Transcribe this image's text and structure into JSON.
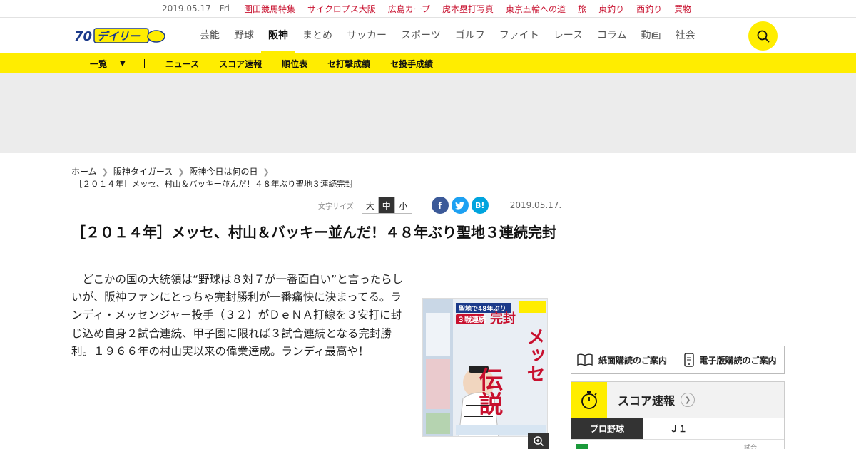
{
  "topbar": {
    "date": "2019.05.17 - Fri",
    "links": [
      "園田競馬特集",
      "サイクロプス大阪",
      "広島カープ",
      "虎本塁打写真",
      "東京五輪への道",
      "旅",
      "東釣り",
      "西釣り",
      "買物"
    ]
  },
  "header": {
    "logo_number": "70",
    "logo_text": "デイリー",
    "nav": [
      "芸能",
      "野球",
      "阪神",
      "まとめ",
      "サッカー",
      "スポーツ",
      "ゴルフ",
      "ファイト",
      "レース",
      "コラム",
      "動画",
      "社会"
    ],
    "active_nav": "阪神",
    "search_icon": "search-icon"
  },
  "subnav": {
    "ichiran": "一覧",
    "links": [
      "ニュース",
      "スコア速報",
      "順位表",
      "セ打撃成績",
      "セ投手成績"
    ]
  },
  "colors": {
    "accent_yellow": "#ffed00",
    "top_link_red": "#c8102e",
    "facebook": "#3b5998",
    "twitter": "#1da1f2",
    "hatena": "#00a4de"
  },
  "breadcrumb": {
    "items": [
      "ホーム",
      "阪神タイガース",
      "阪神今日は何の日"
    ],
    "current": "［２０１４年］メッセ、村山＆バッキー並んだ！４８年ぶり聖地３連続完封"
  },
  "article": {
    "font_size_label": "文字サイズ",
    "font_sizes": [
      "大",
      "中",
      "小"
    ],
    "selected_font_size": "中",
    "share": {
      "facebook": "f",
      "twitter": "t",
      "hatena": "B!"
    },
    "date": "2019.05.17.",
    "headline": "［２０１４年］メッセ、村山＆バッキー並んだ！４８年ぶり聖地３連続完封",
    "body": "どこかの国の大統領は“野球は８対７が一番面白い”と言ったらしいが、阪神ファンにとっちゃ完封勝利が一番痛快に決まってる。ランディ・メッセンジャー投手（３２）がＤｅＮＡ打線を３安打に封じ込め自身２試合連続、甲子園に限れば３試合連続となる完封勝利。１９６６年の村山実以来の偉業達成。ランディ最高や！",
    "image": {
      "headline_big": "完封",
      "headline_side": "メッセ",
      "headline_bottom": "伝説",
      "badge": "３戦連続",
      "sub": "聖地で48年ぶり",
      "zoom_icon": "zoom-in-icon"
    }
  },
  "sidebar": {
    "subscribe_paper": "紙面購読のご案内",
    "subscribe_digital": "電子版購読のご案内",
    "score_title": "スコア速報",
    "score_tabs": [
      "プロ野球",
      "Ｊ１"
    ],
    "score_active_tab": "プロ野球",
    "score_row_note": "試合"
  }
}
